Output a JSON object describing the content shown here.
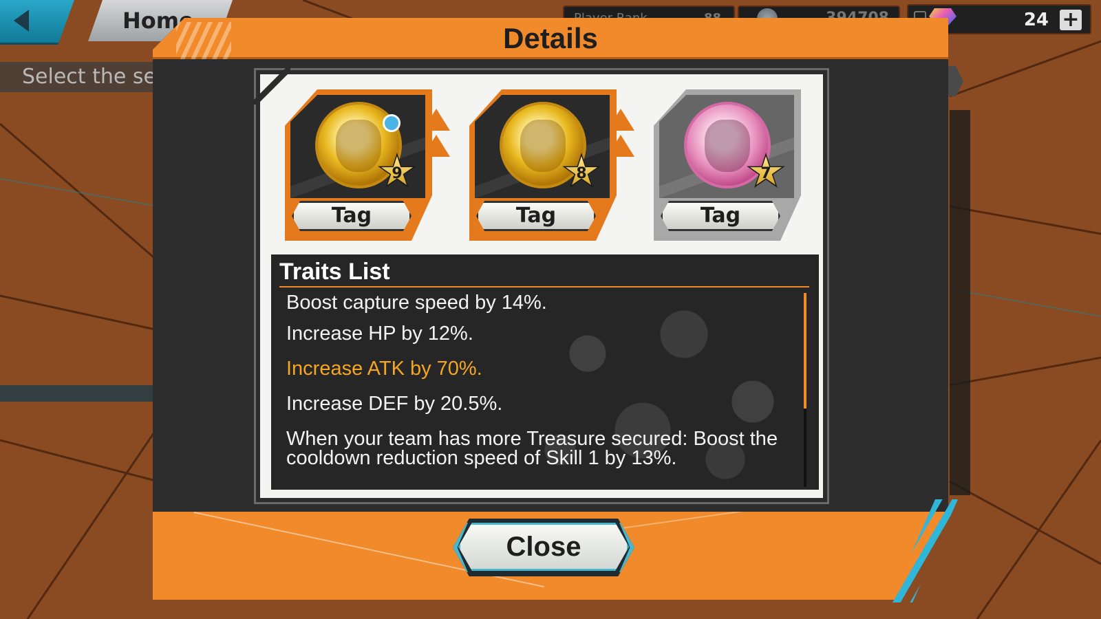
{
  "top_bar": {
    "home_label": "Home",
    "player_rank_label": "Player Rank",
    "player_rank_value": "88",
    "coin_count": "394708",
    "gem_count": "24",
    "add_gems_label": "+"
  },
  "instruction_text": "Select the set you would",
  "dialog": {
    "title": "Details",
    "medals": [
      {
        "tag_label": "Tag",
        "stars": "9",
        "tier": "gold",
        "has_boost_icon": true
      },
      {
        "tag_label": "Tag",
        "stars": "8",
        "tier": "gold",
        "has_boost_icon": false
      },
      {
        "tag_label": "Tag",
        "stars": "7",
        "tier": "pink",
        "has_boost_icon": false
      }
    ],
    "traits": {
      "title": "Traits List",
      "items": [
        {
          "text": "Boost capture speed by 14%.",
          "highlighted": false
        },
        {
          "text": "Increase HP by 12%.",
          "highlighted": false
        },
        {
          "text": "Increase ATK by 70%.",
          "highlighted": true
        },
        {
          "text": "Increase DEF by 20.5%.",
          "highlighted": false
        },
        {
          "text": "When your team has more Treasure secured: Boost the cooldown reduction speed of Skill 1 by 13%.",
          "highlighted": false
        }
      ]
    },
    "close_label": "Close"
  },
  "colors": {
    "accent_orange": "#f08a2a",
    "highlight_text": "#f5a623",
    "cyan_accent": "#47b7cf",
    "panel_dark": "#262626"
  }
}
